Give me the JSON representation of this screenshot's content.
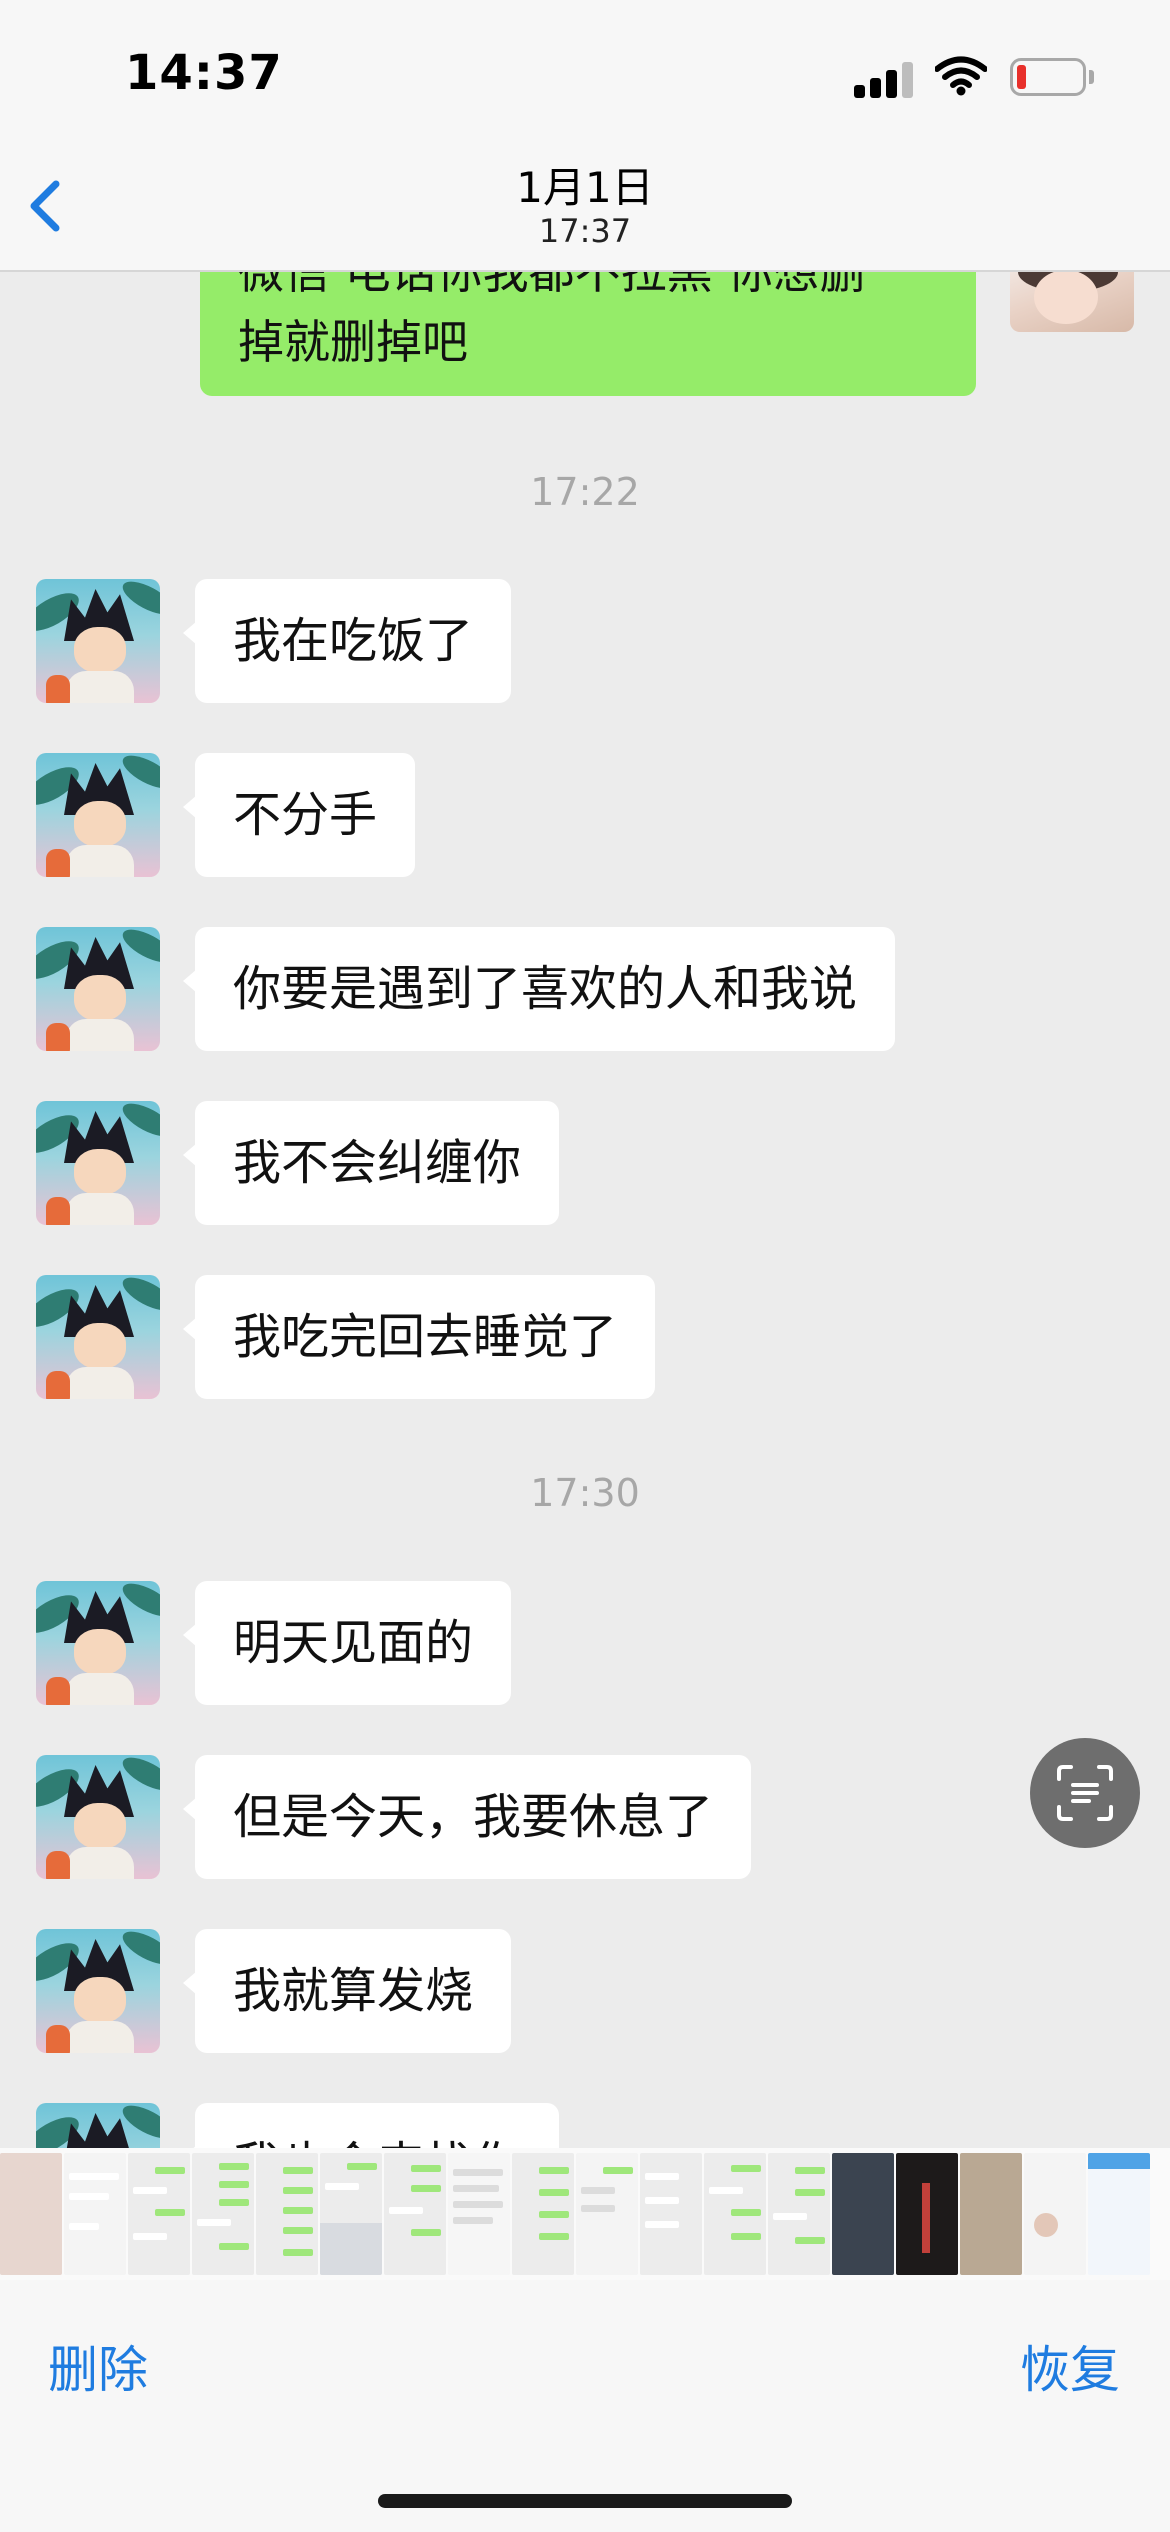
{
  "status_bar": {
    "time": "14:37",
    "icons": [
      "signal-icon",
      "wifi-icon",
      "battery-icon"
    ],
    "battery_color": "#e8302b"
  },
  "nav": {
    "back_icon": "chevron-left-icon",
    "title": "1月1日",
    "subtitle": "17:37",
    "accent_color": "#1f7ce0"
  },
  "chat": {
    "outgoing_partial": {
      "line1": "微信 电话你我都不拉黑 你想删",
      "line2": "掉就删掉吧",
      "bubble_color": "#95ec69"
    },
    "sections": [
      {
        "time": "17:22",
        "messages": [
          "我在吃饭了",
          "不分手",
          "你要是遇到了喜欢的人和我说",
          "我不会纠缠你",
          "我吃完回去睡觉了"
        ]
      },
      {
        "time": "17:30",
        "messages": [
          "明天见面的",
          "但是今天，我要休息了",
          "我就算发烧",
          "我也会来找你"
        ]
      }
    ]
  },
  "scan_button": {
    "icon": "scan-text-icon"
  },
  "bottom_bar": {
    "delete_label": "删除",
    "restore_label": "恢复"
  }
}
